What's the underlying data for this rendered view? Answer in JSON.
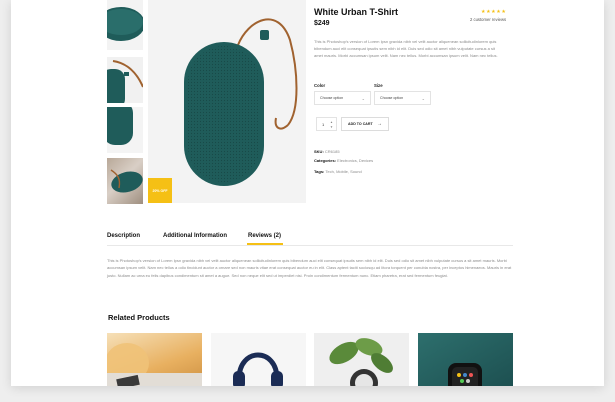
{
  "product": {
    "title": "White Urban T-Shirt",
    "price": "$249",
    "stars": "★★★★★",
    "review_count": "2 customer reviews",
    "description": "This is Photoshop's version of Lorem Ipsn gravida nibh vel velit auctor aliquenean sollicitudinlorem quis bibendum auci elit consequat ipsutis sem nibh id elit. Duis sed odio sit amet nibh vulputate cursus a sit amet mauris. Morbi accumsan ipsum velit. Nam nec tellus. Morbi accumsan ipsum velit. Nam nec tellus.",
    "sale_badge": "20% OFF",
    "quantity": "1",
    "add_to_cart": "ADD TO CART",
    "sku_label": "SKU:",
    "sku_value": "CR6185",
    "categories_label": "Categories:",
    "categories_value": "Electronics, Devices",
    "tags_label": "Tags:",
    "tags_value": "Tech, Mobile, Sound"
  },
  "options": {
    "color_label": "Color",
    "color_value": "Choose option",
    "size_label": "Size",
    "size_value": "Choose option"
  },
  "tabs": {
    "description": "Description",
    "additional": "Additional Information",
    "reviews": "Reviews (2)"
  },
  "tab_content": "This is Photoshop's version of Lorem Ipsn gravida nibh vel velit auctor aliquenean sollicitudinlorem quis bibendum auci elit consequat ipsutis sem nibh id elit. Duis sed odio sit amet nibh vulputate cursus a sit amet mauris. Morbi accumsan ipsum velit. Nam nec tellus a odio tincidunt auctor a ornare sed non mauris vitae erat consequat auctor eu in elit. Class aptent taciti sociosqu ad litora torquent per conubia nostra, per inceptos himenaeos. Mauris in erat justo. Nullam ac urna eu felis dapibus condimentum sit amet a augue. Sed non neque elit sed ut imperdiet nisi. Proin condimentum fermentum nunc. Etiam pharetra, erat sed fermentum feugiat.",
  "related": {
    "title": "Related Products"
  },
  "colors": {
    "accent": "#f5c015",
    "speaker": "#1f5c5a",
    "strap": "#a0622f"
  }
}
